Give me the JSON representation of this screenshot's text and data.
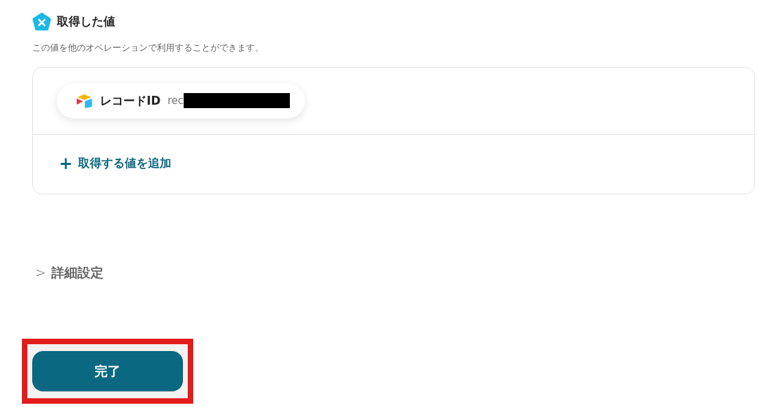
{
  "section": {
    "title": "取得した値",
    "description": "この値を他のオペレーションで利用することができます。"
  },
  "values": [
    {
      "label": "レコードID",
      "value": "rec",
      "redacted": true
    }
  ],
  "add_action": {
    "icon": "+",
    "label": "取得する値を追加"
  },
  "details": {
    "icon": ">",
    "label": "詳細設定",
    "expanded": false
  },
  "complete_button": {
    "label": "完了",
    "highlighted": true
  }
}
